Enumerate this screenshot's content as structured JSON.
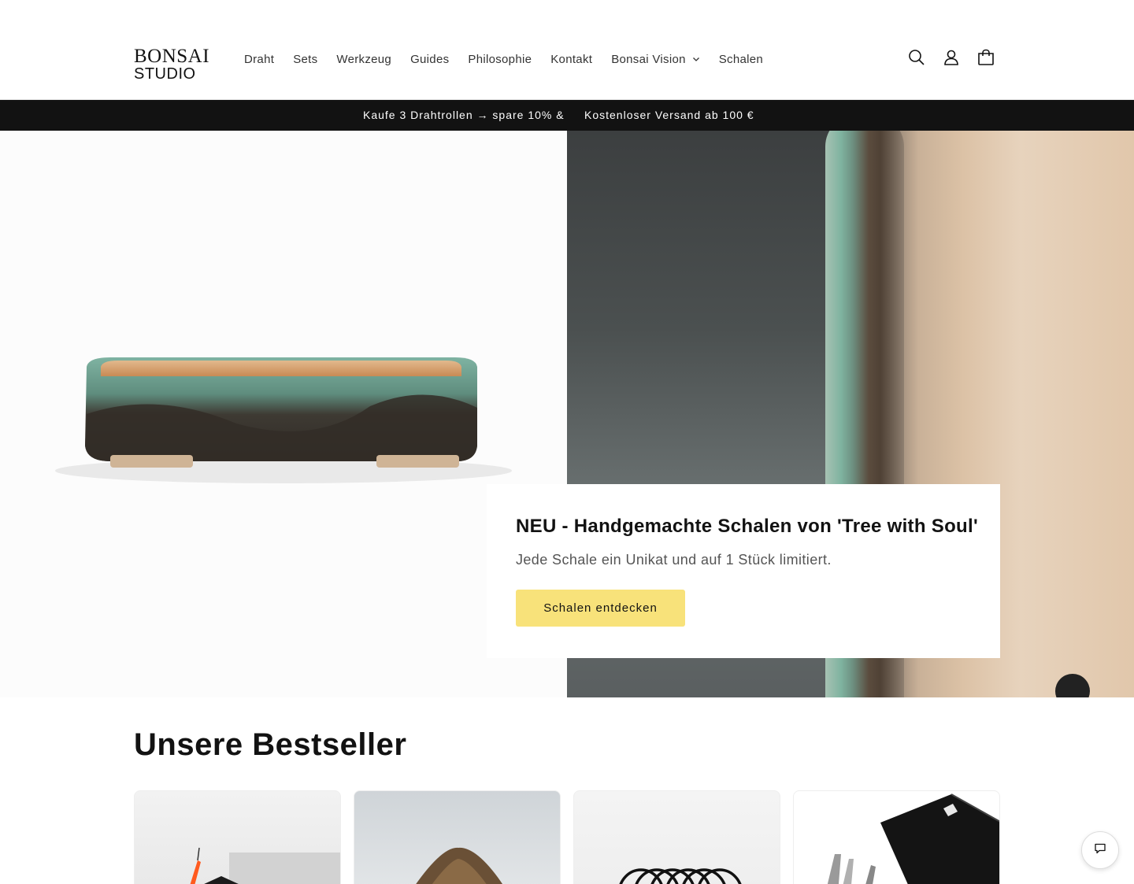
{
  "header": {
    "logo_line1": "BONSAI",
    "logo_line2": "STUDIO",
    "nav": [
      {
        "label": "Draht"
      },
      {
        "label": "Sets"
      },
      {
        "label": "Werkzeug"
      },
      {
        "label": "Guides"
      },
      {
        "label": "Philosophie"
      },
      {
        "label": "Kontakt"
      },
      {
        "label": "Bonsai Vision",
        "icon": "chevron-down-icon"
      },
      {
        "label": "Schalen"
      }
    ],
    "icons": [
      "search-icon",
      "account-icon",
      "cart-icon"
    ]
  },
  "announcement": {
    "item1": "Kaufe 3 Drahtrollen → spare 10% &",
    "item2": "Kostenloser Versand ab 100 €"
  },
  "hero": {
    "title": "NEU - Handgemachte Schalen von 'Tree with Soul'",
    "subtitle": "Jede Schale ein Unikat und auf 1 Stück limitiert.",
    "button_label": "Schalen entdecken",
    "button_color": "#f8e27a"
  },
  "bestsellers": {
    "title": "Unsere Bestseller"
  },
  "chat": {
    "icon": "chat-icon"
  }
}
